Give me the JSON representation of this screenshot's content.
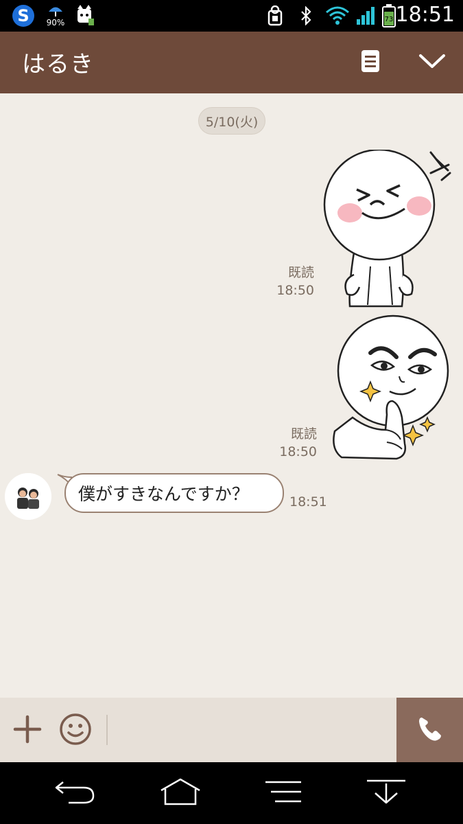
{
  "status_bar": {
    "battery_level": "90%",
    "battery_badge": "73",
    "time": "18:51",
    "icons": [
      "s-app-icon",
      "umbrella-icon",
      "dog-mascot-icon",
      "nfc-icon",
      "bluetooth-icon",
      "wifi-icon",
      "signal-icon",
      "battery-icon"
    ]
  },
  "header": {
    "title": "はるき",
    "actions": [
      "notes-icon",
      "chevron-down-icon"
    ]
  },
  "chat": {
    "date_label": "5/10(火)",
    "messages": [
      {
        "type": "sticker",
        "sticker": "laughing-moon-sticker",
        "read_label": "既読",
        "time": "18:50"
      },
      {
        "type": "sticker",
        "sticker": "thumbs-up-moon-sticker",
        "read_label": "既読",
        "time": "18:50"
      },
      {
        "type": "text",
        "from": "partner",
        "text": "僕がすきなんですか？",
        "time": "18:51"
      }
    ]
  },
  "input_bar": {
    "placeholder": "",
    "icons": [
      "plus-icon",
      "emoji-icon",
      "phone-icon"
    ]
  },
  "nav_bar": {
    "icons": [
      "back-icon",
      "home-icon",
      "menu-icon",
      "notifications-pull-icon"
    ]
  },
  "colors": {
    "header": "#6e4a3a",
    "chat_bg": "#f1ede7",
    "accent": "#8a6a5c",
    "meta_text": "#7a6c60"
  }
}
